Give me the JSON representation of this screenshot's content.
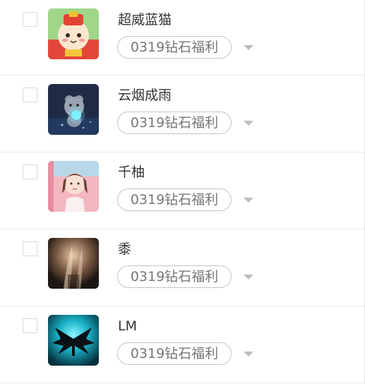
{
  "members": [
    {
      "name": "超威蓝猫",
      "tag": "0319钻石福利",
      "avatar_icon": "cartoon-mascot-avatar-icon"
    },
    {
      "name": "云烟成雨",
      "tag": "0319钻石福利",
      "avatar_icon": "bear-holding-light-avatar-icon"
    },
    {
      "name": "千柚",
      "tag": "0319钻石福利",
      "avatar_icon": "girl-portrait-avatar-icon"
    },
    {
      "name": "黍",
      "tag": "0319钻石福利",
      "avatar_icon": "smoky-scene-avatar-icon"
    },
    {
      "name": "LM",
      "tag": "0319钻石福利",
      "avatar_icon": "winged-silhouette-avatar-icon"
    }
  ],
  "colors": {
    "border": "#e8e8e8",
    "tag_border": "#c4c4c4",
    "tag_text": "#777777",
    "caret": "#bdbdbd"
  }
}
